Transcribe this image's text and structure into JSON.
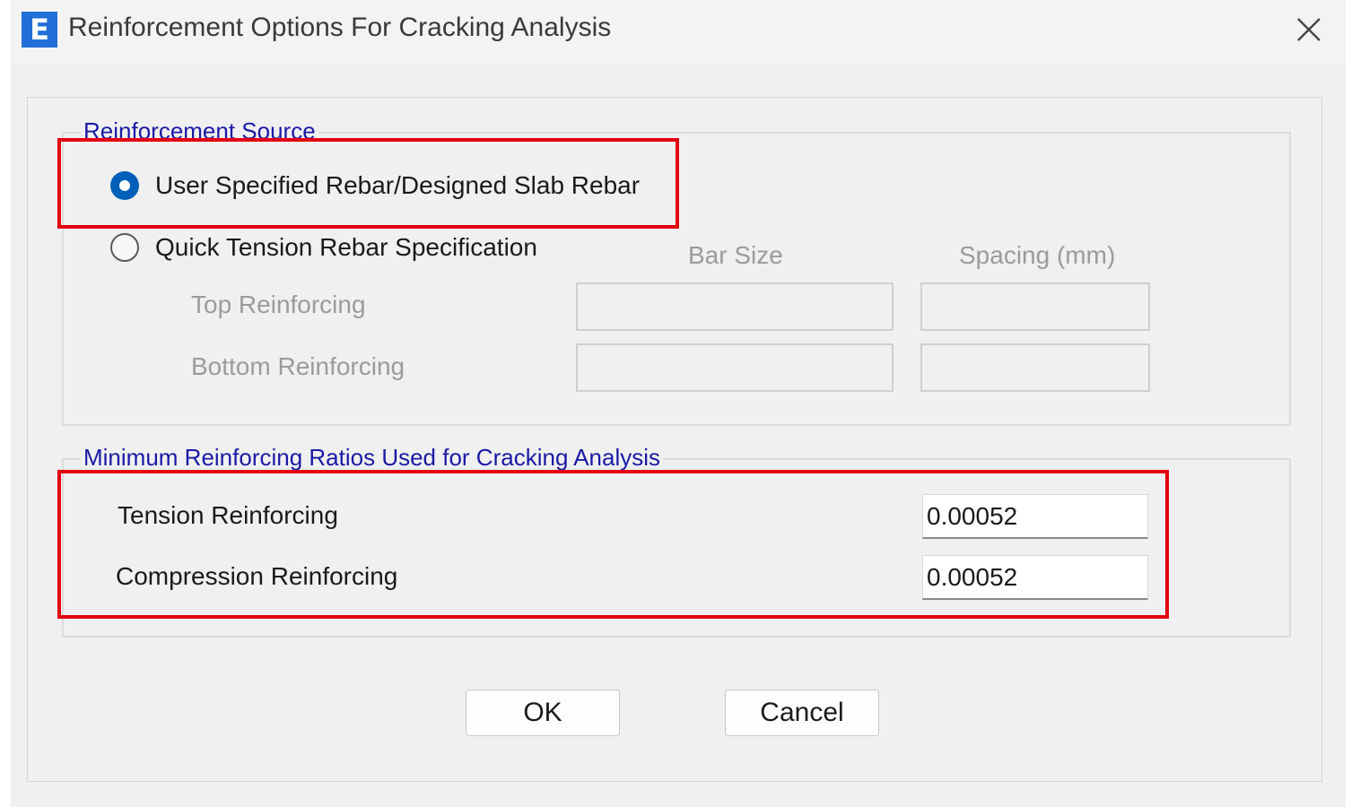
{
  "window": {
    "title": "Reinforcement Options For Cracking Analysis",
    "app_icon_letter": "E",
    "app_icon_color": "#1f6fd6"
  },
  "reinforcement_source": {
    "group_title": "Reinforcement Source",
    "option_user": {
      "label": "User Specified Rebar/Designed Slab Rebar",
      "checked": true
    },
    "option_quick": {
      "label": "Quick Tension Rebar Specification",
      "checked": false
    },
    "col_bar_size": "Bar Size",
    "col_spacing": "Spacing (mm)",
    "top_label": "Top Reinforcing",
    "bottom_label": "Bottom Reinforcing",
    "top_bar_size": "",
    "top_spacing": "",
    "bottom_bar_size": "",
    "bottom_spacing": ""
  },
  "min_ratios": {
    "group_title": "Minimum Reinforcing Ratios Used for Cracking Analysis",
    "tension_label": "Tension Reinforcing",
    "tension_value": "0.00052",
    "compression_label": "Compression Reinforcing",
    "compression_value": "0.00052"
  },
  "buttons": {
    "ok": "OK",
    "cancel": "Cancel"
  },
  "colors": {
    "group_title": "#1a1aa6",
    "radio_selected": "#005fb8",
    "annotation_red": "#e3000f"
  }
}
